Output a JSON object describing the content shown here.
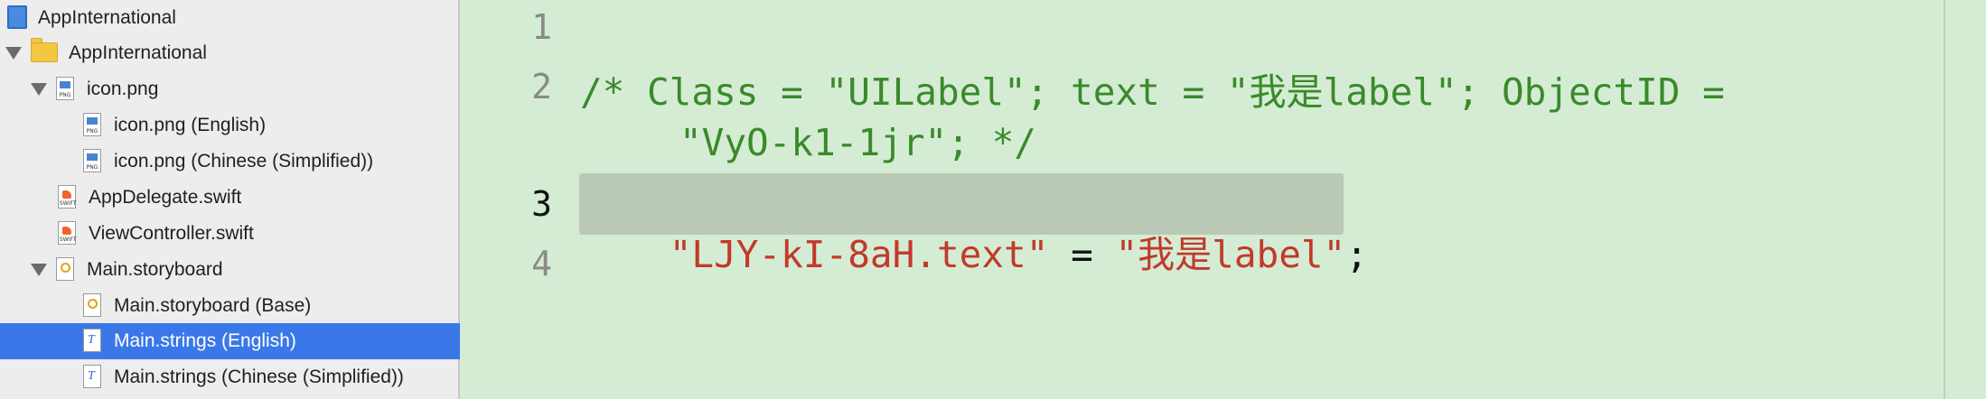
{
  "navigator": {
    "items": [
      {
        "label": "AppInternational",
        "icon": "project-icon",
        "selected": false
      },
      {
        "label": "AppInternational",
        "icon": "folder-icon",
        "selected": false
      },
      {
        "label": "icon.png",
        "icon": "png-file-icon",
        "selected": false
      },
      {
        "label": "icon.png (English)",
        "icon": "png-file-icon",
        "selected": false
      },
      {
        "label": "icon.png (Chinese (Simplified))",
        "icon": "png-file-icon",
        "selected": false
      },
      {
        "label": "AppDelegate.swift",
        "icon": "swift-file-icon",
        "selected": false
      },
      {
        "label": "ViewController.swift",
        "icon": "swift-file-icon",
        "selected": false
      },
      {
        "label": "Main.storyboard",
        "icon": "storyboard-file-icon",
        "selected": false
      },
      {
        "label": "Main.storyboard (Base)",
        "icon": "storyboard-file-icon",
        "selected": false
      },
      {
        "label": "Main.strings (English)",
        "icon": "strings-file-icon",
        "selected": true
      },
      {
        "label": "Main.strings (Chinese (Simplified))",
        "icon": "strings-file-icon",
        "selected": false
      }
    ],
    "png_tag": "PNG",
    "swift_tag": "SWIFT",
    "strings_glyph": "T"
  },
  "editor": {
    "line_numbers": [
      "1",
      "2",
      "3",
      "4"
    ],
    "line2_a": "/* Class = \"UILabel\"; text = \"我是label\"; ObjectID =",
    "line2_b": "\"VyO-k1-1jr\"; */",
    "line3_key": "\"LJY-kI-8aH.text\"",
    "line3_eq": " = ",
    "line3_val": "\"我是label\"",
    "line3_end": ";"
  },
  "colors": {
    "editor_background": "#d5ecd4",
    "comment": "#3a8a2b",
    "string": "#c13a2b",
    "selection": "#3a78e9"
  }
}
